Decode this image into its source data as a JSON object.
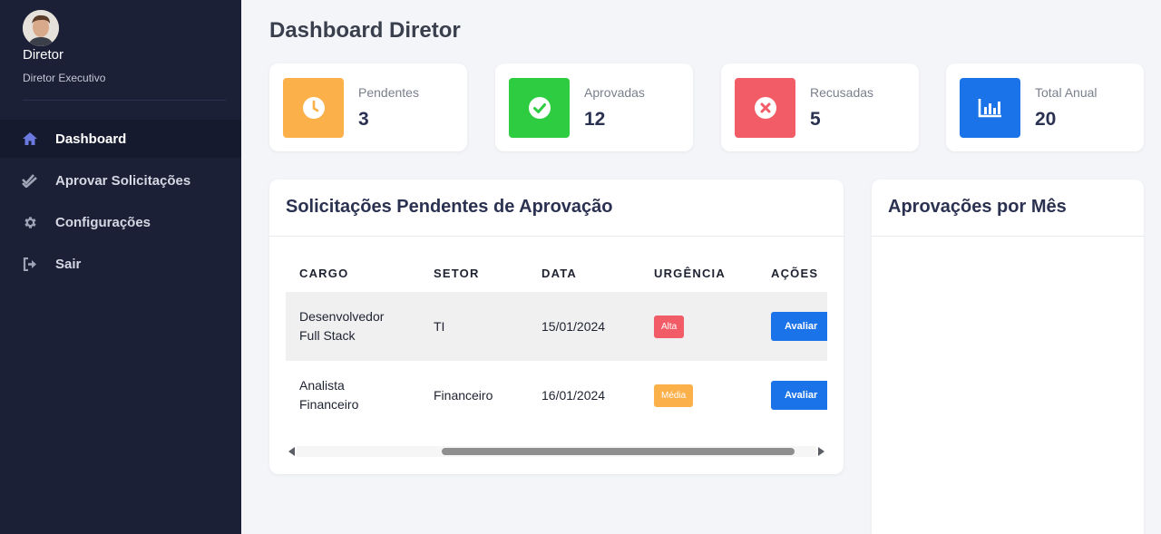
{
  "sidebar": {
    "user_name": "Diretor",
    "user_role": "Diretor Executivo",
    "items": [
      {
        "label": "Dashboard",
        "icon": "home-icon",
        "active": true
      },
      {
        "label": "Aprovar Solicitações",
        "icon": "double-check-icon",
        "active": false
      },
      {
        "label": "Configurações",
        "icon": "gear-icon",
        "active": false
      },
      {
        "label": "Sair",
        "icon": "logout-icon",
        "active": false
      }
    ]
  },
  "page_title": "Dashboard Diretor",
  "stats": [
    {
      "label": "Pendentes",
      "value": "3",
      "color": "#fbb04a",
      "icon": "clock-icon"
    },
    {
      "label": "Aprovadas",
      "value": "12",
      "color": "#2ecc40",
      "icon": "check-circle-icon"
    },
    {
      "label": "Recusadas",
      "value": "5",
      "color": "#f25c66",
      "icon": "x-circle-icon"
    },
    {
      "label": "Total Anual",
      "value": "20",
      "color": "#1a73e8",
      "icon": "bar-chart-icon"
    }
  ],
  "pending": {
    "title": "Solicitações Pendentes de Aprovação",
    "columns": [
      "CARGO",
      "SETOR",
      "DATA",
      "URGÊNCIA",
      "AÇÕES"
    ],
    "rows": [
      {
        "cargo_line1": "Desenvolvedor",
        "cargo_line2": "Full Stack",
        "setor": "TI",
        "data": "15/01/2024",
        "urgencia": "Alta",
        "urgencia_color": "#f25c66",
        "acao": "Avaliar"
      },
      {
        "cargo_line1": "Analista",
        "cargo_line2": "Financeiro",
        "setor": "Financeiro",
        "data": "16/01/2024",
        "urgencia": "Média",
        "urgencia_color": "#fbb04a",
        "acao": "Avaliar"
      }
    ]
  },
  "monthly": {
    "title": "Aprovações por Mês"
  },
  "colors": {
    "sidebar_bg": "#1b2036",
    "active_item_bg": "#151a2e",
    "accent_blue": "#1a73e8",
    "nav_icon_active": "#6c7ae0"
  }
}
